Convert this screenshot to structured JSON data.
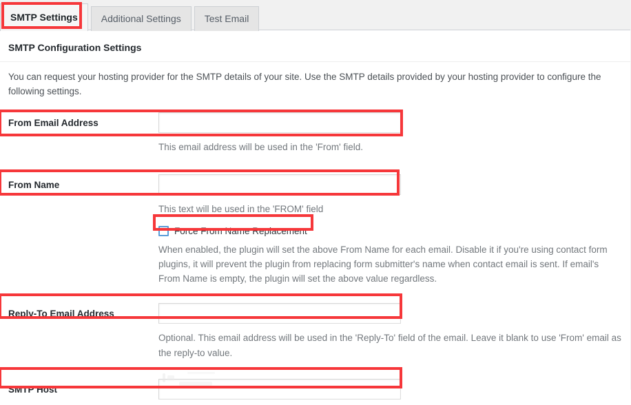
{
  "tabs": [
    {
      "label": "SMTP Settings",
      "active": true
    },
    {
      "label": "Additional Settings",
      "active": false
    },
    {
      "label": "Test Email",
      "active": false
    }
  ],
  "section": {
    "heading": "SMTP Configuration Settings",
    "intro": "You can request your hosting provider for the SMTP details of your site. Use the SMTP details provided by your hosting provider to configure the following settings."
  },
  "fields": {
    "from_email": {
      "label": "From Email Address",
      "value": "",
      "placeholder": "",
      "description": "This email address will be used in the 'From' field."
    },
    "from_name": {
      "label": "From Name",
      "value": "",
      "placeholder": "",
      "description": "This text will be used in the 'FROM' field"
    },
    "force_from_name": {
      "label": "Force From Name Replacement",
      "checked": false,
      "description": "When enabled, the plugin will set the above From Name for each email. Disable it if you're using contact form plugins, it will prevent the plugin from replacing form submitter's name when contact email is sent. If email's From Name is empty, the plugin will set the above value regardless."
    },
    "reply_to": {
      "label": "Reply-To Email Address",
      "value": "",
      "placeholder": "",
      "description": "Optional. This email address will be used in the 'Reply-To' field of the email. Leave it blank to use 'From' email as the reply-to value."
    },
    "smtp_host": {
      "label": "SMTP Host",
      "value": "",
      "placeholder": ""
    }
  },
  "colors": {
    "annotation": "#f6373a",
    "tab_active_bg": "#f6f6f6",
    "tab_inactive_bg": "#e5e5e5",
    "checkbox_border": "#5b9dd9",
    "description_text": "#72777c"
  }
}
